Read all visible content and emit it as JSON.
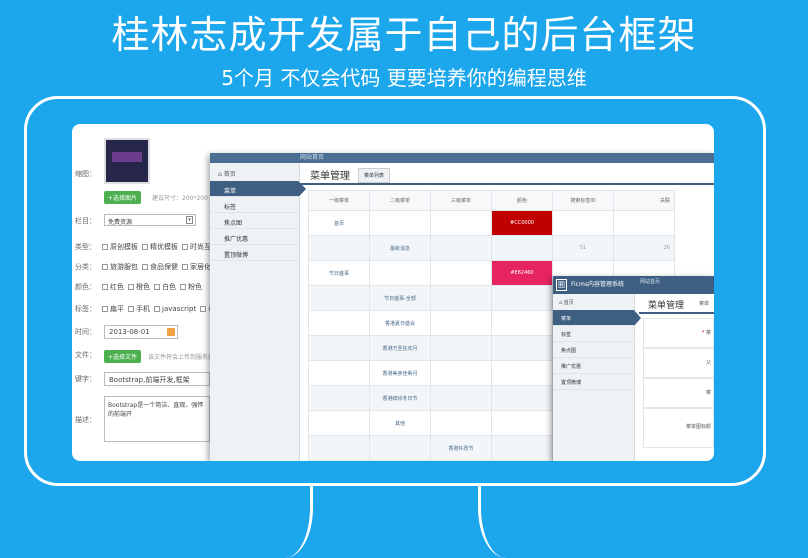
{
  "headline": "桂林志成开发属于自己的后台框架",
  "subline": "5个月 不仅会代码 更要培养你的编程思维",
  "form": {
    "thumbnail_label": "缩图：",
    "upload_button": "+选择图片",
    "upload_hint": "建议尺寸：200*200",
    "column_label": "栏目：",
    "column_value": "免费资源",
    "type_label": "类型：",
    "type_options": [
      "原创模板",
      "精优模板",
      "时尚互动模"
    ],
    "category_label": "分类：",
    "category_options": [
      "旅游服包",
      "食品保健",
      "家居化妆品"
    ],
    "color_label": "颜色：",
    "color_options": [
      "红色",
      "橙色",
      "白色",
      "粉色"
    ],
    "tag_label": "标签：",
    "tag_options": [
      "扁平",
      "手机",
      "javascript",
      "iPho"
    ],
    "time_label": "时间：",
    "time_value": "2013-08-01",
    "file_label": "文件：",
    "file_button": "+选择文件",
    "file_hint": "该文件将会上传到服务器",
    "keyword_label": "键字：",
    "keyword_value": "Bootstrap,前端开发,框架",
    "desc_label": "描述：",
    "desc_value": "Bootstrap是一个简洁、直观、强悍的前端开"
  },
  "menu_window": {
    "top_crumb": "网站首页",
    "home": "首页",
    "sidebar": [
      "菜单",
      "标签",
      "焦点图",
      "推广优惠",
      "置顶微博"
    ],
    "title": "菜单管理",
    "tab": "菜单列表",
    "headers": [
      "一级菜单",
      "二级菜单",
      "三级菜单",
      "颜色",
      "搜索标签ID",
      "关联"
    ],
    "rows": [
      [
        "首页",
        "",
        "",
        "#CC0000",
        "",
        ""
      ],
      [
        "",
        "最新消息",
        "",
        "",
        "51",
        "26"
      ],
      [
        "节日盛事",
        "",
        "",
        "#E62460",
        "",
        ""
      ],
      [
        "",
        "节日盛事-全部",
        "",
        "",
        "",
        ""
      ],
      [
        "",
        "香港夏日盛会",
        "",
        "",
        "",
        ""
      ],
      [
        "",
        "香港万圣狂欢月",
        "",
        "",
        "",
        ""
      ],
      [
        "",
        "香港美食佳肴月",
        "",
        "",
        "",
        ""
      ],
      [
        "",
        "香港缤纷冬日节",
        "",
        "",
        "",
        ""
      ],
      [
        "",
        "其他",
        "",
        "",
        "",
        ""
      ],
      [
        "",
        "",
        "香港许愿节",
        "",
        "",
        ""
      ]
    ]
  },
  "cms_window": {
    "logo": "囿",
    "brand": "Ficms内容管理系统",
    "top_crumb": "网站首页",
    "home": "首页",
    "sidebar": [
      "菜单",
      "标签",
      "焦点图",
      "推广优惠",
      "置顶微博"
    ],
    "title": "菜单管理",
    "tab": "菜单",
    "field_labels": [
      "菜",
      "父",
      "菜",
      "菜单图标颜"
    ],
    "required_mark": "*"
  },
  "colors": {
    "background": "#1ca6ec",
    "nav_dark": "#3e5f82",
    "red": "#c00000",
    "pink": "#e62460",
    "green": "#4caf50"
  }
}
